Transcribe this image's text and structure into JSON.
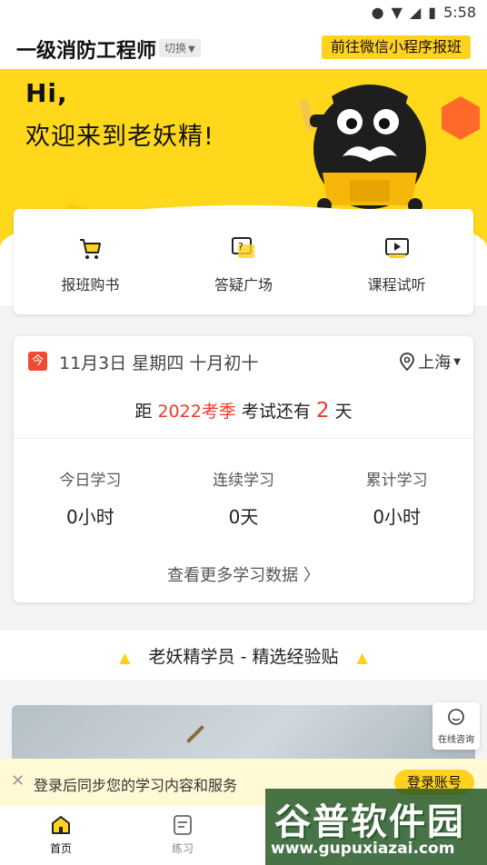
{
  "status_bar": {
    "time": "5:58"
  },
  "header": {
    "title": "一级消防工程师",
    "switch_label": "切换",
    "cta_label": "前往微信小程序报班"
  },
  "hero": {
    "greeting_hi": "Hi,",
    "greeting_main": "欢迎来到老妖精!"
  },
  "quick_actions": [
    {
      "label": "报班购书",
      "icon": "shopping-cart-icon"
    },
    {
      "label": "答疑广场",
      "icon": "question-chat-icon"
    },
    {
      "label": "课程试听",
      "icon": "video-play-icon"
    }
  ],
  "info": {
    "today_badge": "今",
    "date": "11月3日 星期四 十月初十",
    "location": "上海",
    "countdown": {
      "prefix": "距",
      "season": "2022考季",
      "middle": "考试还有",
      "days": "2",
      "suffix": "天"
    },
    "stats": [
      {
        "label": "今日学习",
        "value": "0小时"
      },
      {
        "label": "连续学习",
        "value": "0天"
      },
      {
        "label": "累计学习",
        "value": "0小时"
      }
    ],
    "more_link": "查看更多学习数据 〉"
  },
  "section": {
    "title": "老妖精学员 - 精选经验贴"
  },
  "consult": {
    "label": "在线咨询"
  },
  "login_banner": {
    "message": "登录后同步您的学习内容和服务",
    "button": "登录账号"
  },
  "nav": [
    {
      "label": "首页",
      "active": true
    },
    {
      "label": "练习",
      "active": false
    }
  ],
  "watermark": {
    "text": "谷普软件园",
    "url": "www.gupuxiazai.com"
  },
  "colors": {
    "brand_yellow": "#ffd81c",
    "accent_red": "#ee3a2a"
  }
}
